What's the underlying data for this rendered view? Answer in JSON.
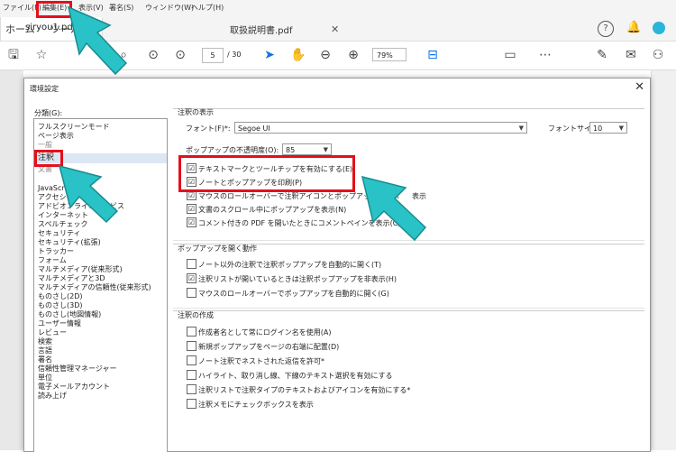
{
  "menubar": {
    "items": [
      "ファイル(F)",
      "編集(E)",
      "表示(V)",
      "署名(S)",
      "ウィンドウ(W)",
      "ヘルプ(H)"
    ]
  },
  "tabs": {
    "home": "ホーム",
    "tools": "ツール",
    "doc1": "siryou1.pdf",
    "doc2": "取扱説明書.pdf"
  },
  "toolbar": {
    "page_current": "5",
    "page_total": "/ 30",
    "zoom": "79%"
  },
  "dialog": {
    "title": "環境設定",
    "close": "✕",
    "categories_label": "分類(G):",
    "categories": [
      "フルスクリーンモード",
      "ページ表示",
      "一般",
      "注釈",
      "文書",
      "",
      "JavaScript",
      "アクセシビリティ",
      "アドビオンラインサービス",
      "インターネット",
      "スペルチェック",
      "セキュリティ",
      "セキュリティ(拡張)",
      "トラッカー",
      "フォーム",
      "マルチメディア(従来形式)",
      "マルチメディアと3D",
      "マルチメディアの信頼性(従来形式)",
      "ものさし(2D)",
      "ものさし(3D)",
      "ものさし(地図情報)",
      "ユーザー情報",
      "レビュー",
      "検索",
      "言語",
      "署名",
      "信頼性管理マネージャー",
      "単位",
      "電子メールアカウント",
      "読み上げ"
    ],
    "selected_category": "注釈",
    "display": {
      "title": "注釈の表示",
      "font_label": "フォント(F)*:",
      "font_value": "Segoe UI",
      "font_size_label": "フォントサイズ(S)*:",
      "font_size_value": "10",
      "opacity_label": "ポップアップの不透明度(O):",
      "opacity_value": "85",
      "options": [
        {
          "label": "テキストマークとツールチップを有効にする(E)",
          "checked": "☑"
        },
        {
          "label": "ノートとポップアップを印刷(P)",
          "checked": "☑"
        },
        {
          "label": "マウスのロールオーバーで注釈アイコンとポップアップを表示",
          "checked": "☑"
        },
        {
          "label": "文書のスクロール中にポップアップを表示(N)",
          "checked": "☑"
        },
        {
          "label": "コメント付きの PDF を開いたときにコメントペインを表示(C)",
          "checked": "☑"
        }
      ]
    },
    "popup_open": {
      "title": "ポップアップを開く動作",
      "options": [
        {
          "label": "ノート以外の注釈で注釈ポップアップを自動的に開く(T)",
          "checked": ""
        },
        {
          "label": "注釈リストが開いているときは注釈ポップアップを非表示(H)",
          "checked": "☑"
        },
        {
          "label": "マウスのロールオーバーでポップアップを自動的に開く(G)",
          "checked": ""
        }
      ]
    },
    "create": {
      "title": "注釈の作成",
      "options": [
        {
          "label": "作成者名として常にログイン名を使用(A)",
          "checked": ""
        },
        {
          "label": "新規ポップアップをページの右端に配置(D)",
          "checked": ""
        },
        {
          "label": "ノート注釈でネストされた返信を許可*",
          "checked": ""
        },
        {
          "label": "ハイライト、取り消し線、下線のテキスト選択を有効にする",
          "checked": ""
        },
        {
          "label": "注釈リストで注釈タイプのテキストおよびアイコンを有効にする*",
          "checked": ""
        },
        {
          "label": "注釈メモにチェックボックスを表示",
          "checked": ""
        }
      ]
    },
    "overflow_text": "表示"
  },
  "icons": [
    "save-icon",
    "star-icon",
    "search-icon",
    "up-icon",
    "down-icon",
    "cursor-icon",
    "hand-icon",
    "zoom-out-icon",
    "zoom-in-icon",
    "fit-page-icon",
    "comment-icon",
    "more-icon",
    "sign-icon",
    "mail-icon",
    "account-icon",
    "help-icon",
    "bell-icon"
  ],
  "colors": {
    "annotation_red": "#e3101b",
    "annotation_cyan": "#29c2c6",
    "accent_blue": "#1473e6"
  }
}
